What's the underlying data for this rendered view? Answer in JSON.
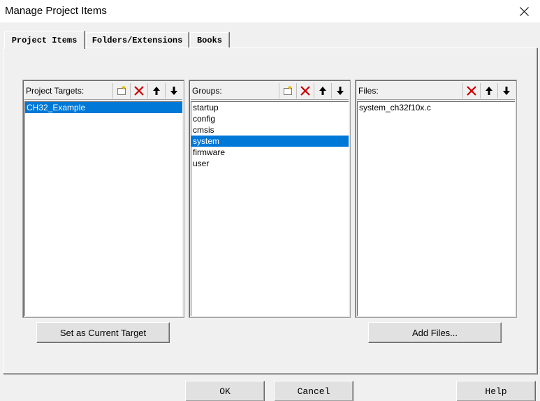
{
  "window": {
    "title": "Manage Project Items"
  },
  "tabs": [
    {
      "label": "Project Items",
      "active": true
    },
    {
      "label": "Folders/Extensions",
      "active": false
    },
    {
      "label": "Books",
      "active": false
    }
  ],
  "targets": {
    "title": "Project Targets:",
    "items": [
      "CH32_Example"
    ],
    "selected": "CH32_Example"
  },
  "groups": {
    "title": "Groups:",
    "items": [
      "startup",
      "config",
      "cmsis",
      "system",
      "firmware",
      "user"
    ],
    "selected": "system"
  },
  "files": {
    "title": "Files:",
    "items": [
      "system_ch32f10x.c"
    ]
  },
  "buttons": {
    "set_current_target": "Set as Current Target",
    "add_files": "Add Files...",
    "ok": "OK",
    "cancel": "Cancel",
    "help": "Help"
  },
  "icons": {
    "new": "new-item-icon",
    "delete": "delete-icon",
    "up": "move-up-icon",
    "down": "move-down-icon",
    "close": "close-icon"
  },
  "colors": {
    "selection": "#0078d7",
    "delete_red": "#cc0000"
  }
}
